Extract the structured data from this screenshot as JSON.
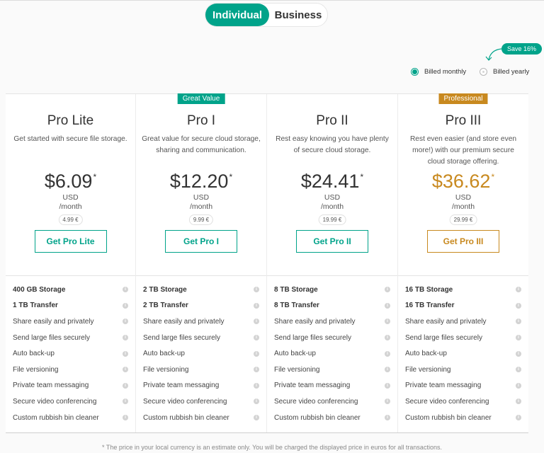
{
  "toggle": {
    "individual": "Individual",
    "business": "Business"
  },
  "save_badge": "Save 16%",
  "billing": {
    "monthly": "Billed monthly",
    "yearly": "Billed yearly"
  },
  "colors": {
    "accent": "#00a38a",
    "gold": "#c8891f"
  },
  "plans": [
    {
      "name": "Pro Lite",
      "tag": "",
      "description": "Get started with secure file storage.",
      "price": "$6.09",
      "asterisk": "*",
      "currency": "USD",
      "period": "/month",
      "eur": "4.99 €",
      "button": "Get Pro Lite",
      "features": [
        "400 GB Storage",
        "1 TB Transfer",
        "Share easily and privately",
        "Send large files securely",
        "Auto back-up",
        "File versioning",
        "Private team messaging",
        "Secure video conferencing",
        "Custom rubbish bin cleaner"
      ]
    },
    {
      "name": "Pro I",
      "tag": "Great Value",
      "description": "Great value for secure cloud storage, sharing and communication.",
      "price": "$12.20",
      "asterisk": "*",
      "currency": "USD",
      "period": "/month",
      "eur": "9.99 €",
      "button": "Get Pro I",
      "features": [
        "2 TB Storage",
        "2 TB Transfer",
        "Share easily and privately",
        "Send large files securely",
        "Auto back-up",
        "File versioning",
        "Private team messaging",
        "Secure video conferencing",
        "Custom rubbish bin cleaner"
      ]
    },
    {
      "name": "Pro II",
      "tag": "",
      "description": "Rest easy knowing you have plenty of secure cloud storage.",
      "price": "$24.41",
      "asterisk": "*",
      "currency": "USD",
      "period": "/month",
      "eur": "19.99 €",
      "button": "Get Pro II",
      "features": [
        "8 TB Storage",
        "8 TB Transfer",
        "Share easily and privately",
        "Send large files securely",
        "Auto back-up",
        "File versioning",
        "Private team messaging",
        "Secure video conferencing",
        "Custom rubbish bin cleaner"
      ]
    },
    {
      "name": "Pro III",
      "tag": "Professional",
      "description": "Rest even easier (and store even more!) with our premium secure cloud storage offering.",
      "price": "$36.62",
      "asterisk": "*",
      "currency": "USD",
      "period": "/month",
      "eur": "29.99 €",
      "button": "Get Pro III",
      "features": [
        "16 TB Storage",
        "16 TB Transfer",
        "Share easily and privately",
        "Send large files securely",
        "Auto back-up",
        "File versioning",
        "Private team messaging",
        "Secure video conferencing",
        "Custom rubbish bin cleaner"
      ]
    }
  ],
  "footnote": "* The price in your local currency is an estimate only. You will be charged the displayed price in euros for all transactions."
}
